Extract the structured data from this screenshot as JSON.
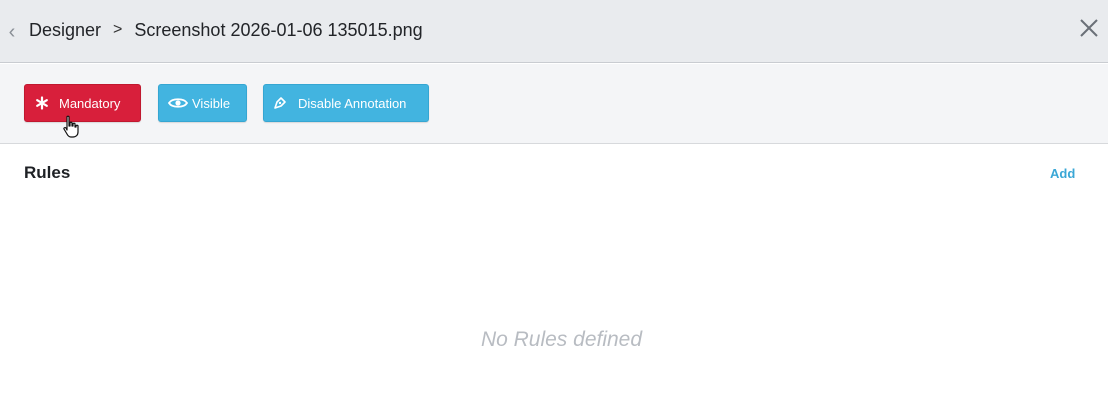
{
  "header": {
    "back_icon": "chevron-left-icon",
    "breadcrumb_root": "Designer",
    "breadcrumb_separator": ">",
    "breadcrumb_current": "Screenshot 2026-01-06 135015.png",
    "close_icon": "close-icon"
  },
  "toolbar": {
    "mandatory_label": "Mandatory",
    "mandatory_icon": "asterisk-icon",
    "mandatory_color": "#d81f3b",
    "visible_label": "Visible",
    "visible_icon": "eye-icon",
    "disable_annotation_label": "Disable Annotation",
    "disable_annotation_icon": "pen-icon",
    "info_color": "#42b4e0"
  },
  "rules": {
    "title": "Rules",
    "add_label": "Add",
    "empty_message": "No Rules defined"
  }
}
